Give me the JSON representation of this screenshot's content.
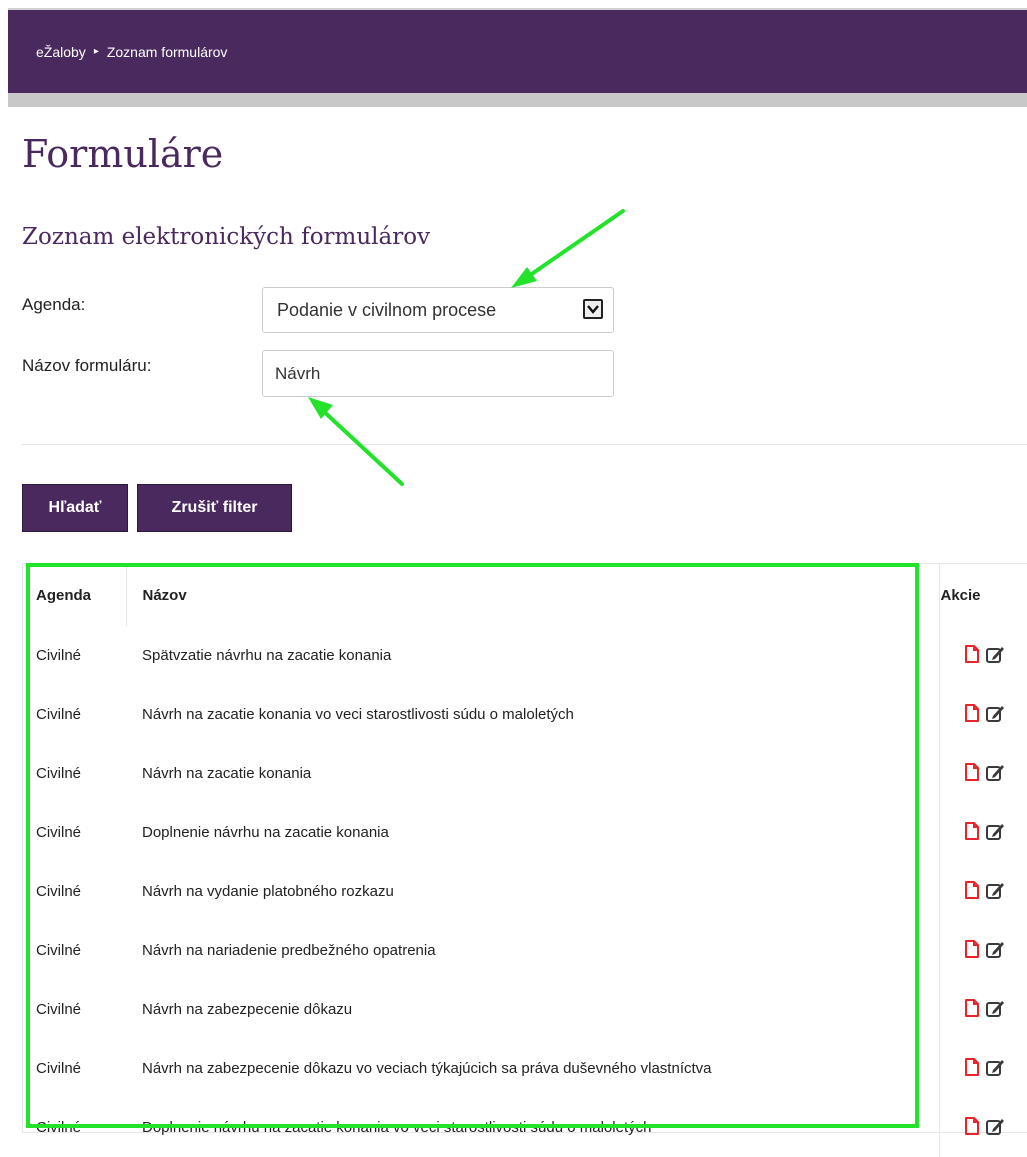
{
  "breadcrumb": {
    "root": "eŽaloby",
    "separator": "▸",
    "current": "Zoznam formulárov"
  },
  "page_title": "Formuláre",
  "section_title": "Zoznam elektronických formulárov",
  "filters": {
    "agenda_label": "Agenda:",
    "agenda_value": "Podanie v civilnom procese",
    "name_label": "Názov formuláru:",
    "name_value": "Návrh"
  },
  "buttons": {
    "search": "Hľadať",
    "clear_filter": "Zrušiť filter"
  },
  "table": {
    "headers": {
      "agenda": "Agenda",
      "name": "Názov",
      "actions": "Akcie"
    },
    "rows": [
      {
        "agenda": "Civilné",
        "name": "Spätvzatie návrhu na zacatie konania"
      },
      {
        "agenda": "Civilné",
        "name": "Návrh na zacatie konania vo veci starostlivosti súdu o maloletých"
      },
      {
        "agenda": "Civilné",
        "name": "Návrh na zacatie konania"
      },
      {
        "agenda": "Civilné",
        "name": "Doplnenie návrhu na zacatie konania"
      },
      {
        "agenda": "Civilné",
        "name": "Návrh na vydanie platobného rozkazu"
      },
      {
        "agenda": "Civilné",
        "name": "Návrh na nariadenie predbežného opatrenia"
      },
      {
        "agenda": "Civilné",
        "name": "Návrh na zabezpecenie dôkazu"
      },
      {
        "agenda": "Civilné",
        "name": "Návrh na zabezpecenie dôkazu vo veciach týkajúcich sa práva duševného vlastníctva"
      },
      {
        "agenda": "Civilné",
        "name": "Doplnenie návrhu na zacatie konania vo veci starostlivosti súdu o maloletých"
      }
    ],
    "row_icons": [
      "pdf-file-icon",
      "edit-icon"
    ]
  },
  "colors": {
    "brand": "#4a2a5e",
    "annotation": "#22e22a",
    "pdf_icon": "#e8232a",
    "edit_icon": "#3a3a3a"
  }
}
